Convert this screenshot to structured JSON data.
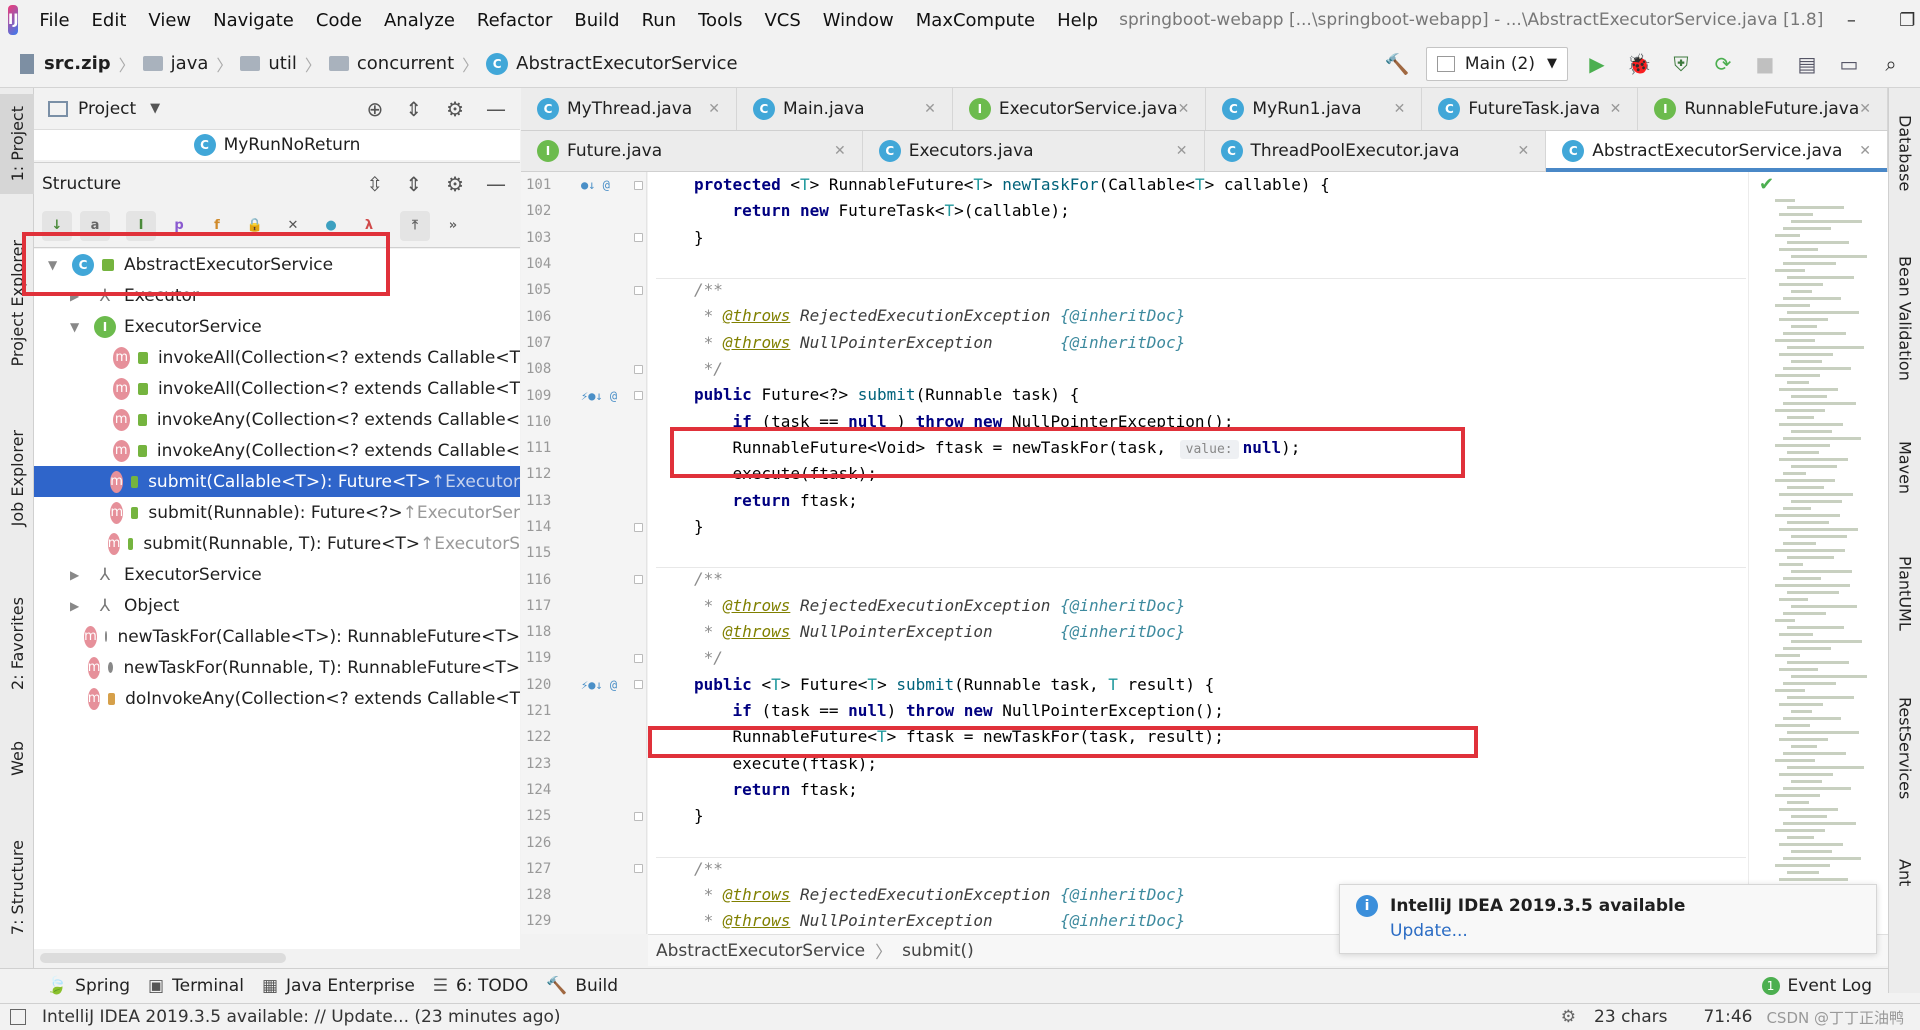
{
  "window": {
    "title": "springboot-webapp [...\\springboot-webapp] - ...\\AbstractExecutorService.java [1.8]",
    "controls": [
      "–",
      "❐",
      "✕"
    ]
  },
  "menu": [
    "File",
    "Edit",
    "View",
    "Navigate",
    "Code",
    "Analyze",
    "Refactor",
    "Build",
    "Run",
    "Tools",
    "VCS",
    "Window",
    "MaxCompute",
    "Help"
  ],
  "breadcrumb": [
    "src.zip",
    "java",
    "util",
    "concurrent",
    "AbstractExecutorService"
  ],
  "run_config": "Main (2)",
  "left_tabs": [
    "1: Project",
    "Project Explorer",
    "Job Explorer",
    "2: Favorites",
    "Web",
    "7: Structure"
  ],
  "right_tabs": [
    "Database",
    "Bean Validation",
    "Maven",
    "PlantUML",
    "RestServices",
    "Ant"
  ],
  "project_panel": {
    "title": "Project",
    "file": "MyRunNoReturn"
  },
  "structure_panel": {
    "title": "Structure"
  },
  "tree": [
    {
      "text": "AbstractExecutorService",
      "suffix": "",
      "indent": 0,
      "icon": "C",
      "arrow": "▼",
      "acc": "lock"
    },
    {
      "text": "Executor",
      "suffix": "",
      "indent": 1,
      "icon": "inherit",
      "arrow": "▶",
      "acc": ""
    },
    {
      "text": "ExecutorService",
      "suffix": "",
      "indent": 1,
      "icon": "I",
      "arrow": "▼",
      "acc": ""
    },
    {
      "text": "invokeAll(Collection<? extends Callable<T",
      "suffix": "",
      "indent": 2,
      "icon": "m",
      "arrow": "",
      "acc": "lock"
    },
    {
      "text": "invokeAll(Collection<? extends Callable<T",
      "suffix": "",
      "indent": 2,
      "icon": "m",
      "arrow": "",
      "acc": "lock"
    },
    {
      "text": "invokeAny(Collection<? extends Callable<",
      "suffix": "",
      "indent": 2,
      "icon": "m",
      "arrow": "",
      "acc": "lock"
    },
    {
      "text": "invokeAny(Collection<? extends Callable<",
      "suffix": "",
      "indent": 2,
      "icon": "m",
      "arrow": "",
      "acc": "lock"
    },
    {
      "text": "submit(Callable<T>): Future<T> ",
      "suffix": "↑Executor",
      "indent": 2,
      "icon": "m",
      "arrow": "",
      "acc": "lock",
      "selected": true
    },
    {
      "text": "submit(Runnable): Future<?> ",
      "suffix": "↑ExecutorSer",
      "indent": 2,
      "icon": "m",
      "arrow": "",
      "acc": "lock"
    },
    {
      "text": "submit(Runnable, T): Future<T> ",
      "suffix": "↑ExecutorS",
      "indent": 2,
      "icon": "m",
      "arrow": "",
      "acc": "lock"
    },
    {
      "text": "ExecutorService",
      "suffix": "",
      "indent": 1,
      "icon": "inherit",
      "arrow": "▶",
      "acc": ""
    },
    {
      "text": "Object",
      "suffix": "",
      "indent": 1,
      "icon": "inherit",
      "arrow": "▶",
      "acc": ""
    },
    {
      "text": "newTaskFor(Callable<T>): RunnableFuture<T>",
      "suffix": "",
      "indent": 1,
      "icon": "m",
      "arrow": "",
      "acc": "key"
    },
    {
      "text": "newTaskFor(Runnable, T): RunnableFuture<T>",
      "suffix": "",
      "indent": 1,
      "icon": "m",
      "arrow": "",
      "acc": "key"
    },
    {
      "text": "doInvokeAny(Collection<? extends Callable<T",
      "suffix": "",
      "indent": 1,
      "icon": "m",
      "arrow": "",
      "acc": "private"
    }
  ],
  "tabs_row1": [
    {
      "label": "MyThread.java",
      "icon": "C"
    },
    {
      "label": "Main.java",
      "icon": "C"
    },
    {
      "label": "ExecutorService.java",
      "icon": "I"
    },
    {
      "label": "MyRun1.java",
      "icon": "C"
    },
    {
      "label": "FutureTask.java",
      "icon": "C"
    },
    {
      "label": "RunnableFuture.java",
      "icon": "I"
    }
  ],
  "tabs_row2": [
    {
      "label": "Future.java",
      "icon": "I"
    },
    {
      "label": "Executors.java",
      "icon": "C"
    },
    {
      "label": "ThreadPoolExecutor.java",
      "icon": "C"
    },
    {
      "label": "AbstractExecutorService.java",
      "icon": "C",
      "active": true
    }
  ],
  "gutter": [
    {
      "n": "101",
      "icons": "●↓ @",
      "fold": true
    },
    {
      "n": "102",
      "icons": "",
      "fold": false
    },
    {
      "n": "103",
      "icons": "",
      "fold": true
    },
    {
      "n": "104",
      "icons": "",
      "fold": false
    },
    {
      "n": "105",
      "icons": "",
      "fold": true
    },
    {
      "n": "106",
      "icons": "",
      "fold": false
    },
    {
      "n": "107",
      "icons": "",
      "fold": false
    },
    {
      "n": "108",
      "icons": "",
      "fold": true
    },
    {
      "n": "109",
      "icons": "⚡●↓ @",
      "fold": true
    },
    {
      "n": "110",
      "icons": "",
      "fold": false
    },
    {
      "n": "111",
      "icons": "",
      "fold": false
    },
    {
      "n": "112",
      "icons": "",
      "fold": false
    },
    {
      "n": "113",
      "icons": "",
      "fold": false
    },
    {
      "n": "114",
      "icons": "",
      "fold": true
    },
    {
      "n": "115",
      "icons": "",
      "fold": false
    },
    {
      "n": "116",
      "icons": "",
      "fold": true
    },
    {
      "n": "117",
      "icons": "",
      "fold": false
    },
    {
      "n": "118",
      "icons": "",
      "fold": false
    },
    {
      "n": "119",
      "icons": "",
      "fold": true
    },
    {
      "n": "120",
      "icons": "⚡●↓ @",
      "fold": true
    },
    {
      "n": "121",
      "icons": "",
      "fold": false
    },
    {
      "n": "122",
      "icons": "",
      "fold": false
    },
    {
      "n": "123",
      "icons": "",
      "fold": false
    },
    {
      "n": "124",
      "icons": "",
      "fold": false
    },
    {
      "n": "125",
      "icons": "",
      "fold": true
    },
    {
      "n": "126",
      "icons": "",
      "fold": false
    },
    {
      "n": "127",
      "icons": "",
      "fold": true
    },
    {
      "n": "128",
      "icons": "",
      "fold": false
    },
    {
      "n": "129",
      "icons": "",
      "fold": false
    }
  ],
  "code": [
    [
      [
        "kw",
        "protected "
      ],
      [
        "",
        "<"
      ],
      [
        "tp",
        "T"
      ],
      [
        "",
        "> RunnableFuture<"
      ],
      [
        "tp",
        "T"
      ],
      [
        "",
        "> "
      ],
      [
        "mth",
        "newTaskFor"
      ],
      [
        "",
        "(Callable<"
      ],
      [
        "tp",
        "T"
      ],
      [
        "",
        "> callable) {"
      ]
    ],
    [
      [
        "",
        "    "
      ],
      [
        "kw",
        "return new "
      ],
      [
        "",
        "FutureTask<"
      ],
      [
        "tp",
        "T"
      ],
      [
        "",
        ">(callable);"
      ]
    ],
    [
      [
        "",
        "}"
      ]
    ],
    [],
    [
      [
        "cm",
        "/**"
      ]
    ],
    [
      [
        "cm",
        " * "
      ],
      [
        "ct",
        "@throws"
      ],
      [
        "ctl",
        " RejectedExecutionException "
      ],
      [
        "cd",
        "{@inheritDoc}"
      ]
    ],
    [
      [
        "cm",
        " * "
      ],
      [
        "ct",
        "@throws"
      ],
      [
        "ctl",
        " NullPointerException       "
      ],
      [
        "cd",
        "{@inheritDoc}"
      ]
    ],
    [
      [
        "cm",
        " */"
      ]
    ],
    [
      [
        "kw",
        "public "
      ],
      [
        "",
        "Future<?> "
      ],
      [
        "mth",
        "submit"
      ],
      [
        "",
        "(Runnable task) {"
      ]
    ],
    [
      [
        "",
        "    "
      ],
      [
        "kw",
        "if "
      ],
      [
        "",
        "(task == "
      ],
      [
        "kw",
        "null"
      ],
      [
        "",
        " ) "
      ],
      [
        "kw",
        "throw new "
      ],
      [
        "",
        "NullPointerException();"
      ]
    ],
    [
      [
        "",
        "    RunnableFuture<Void> ftask = newTaskFor(task, "
      ],
      [
        "hint",
        "value:"
      ],
      [
        "kw",
        "null"
      ],
      [
        "",
        ");"
      ]
    ],
    [
      [
        "",
        "    execute(ftask);"
      ]
    ],
    [
      [
        "",
        "    "
      ],
      [
        "kw",
        "return "
      ],
      [
        "",
        "ftask;"
      ]
    ],
    [
      [
        "",
        "}"
      ]
    ],
    [],
    [
      [
        "cm",
        "/**"
      ]
    ],
    [
      [
        "cm",
        " * "
      ],
      [
        "ct",
        "@throws"
      ],
      [
        "ctl",
        " RejectedExecutionException "
      ],
      [
        "cd",
        "{@inheritDoc}"
      ]
    ],
    [
      [
        "cm",
        " * "
      ],
      [
        "ct",
        "@throws"
      ],
      [
        "ctl",
        " NullPointerException       "
      ],
      [
        "cd",
        "{@inheritDoc}"
      ]
    ],
    [
      [
        "cm",
        " */"
      ]
    ],
    [
      [
        "kw",
        "public "
      ],
      [
        "",
        "<"
      ],
      [
        "tp",
        "T"
      ],
      [
        "",
        "> Future<"
      ],
      [
        "tp",
        "T"
      ],
      [
        "",
        "> "
      ],
      [
        "mth",
        "submit"
      ],
      [
        "",
        "(Runnable task, "
      ],
      [
        "tp",
        "T"
      ],
      [
        "",
        " result) {"
      ]
    ],
    [
      [
        "",
        "    "
      ],
      [
        "kw",
        "if "
      ],
      [
        "",
        "(task == "
      ],
      [
        "kw",
        "null"
      ],
      [
        "",
        ") "
      ],
      [
        "kw",
        "throw new "
      ],
      [
        "",
        "NullPointerException();"
      ]
    ],
    [
      [
        "",
        "    RunnableFuture<"
      ],
      [
        "tp",
        "T"
      ],
      [
        "",
        "> ftask = newTaskFor(task, result);"
      ]
    ],
    [
      [
        "",
        "    execute(ftask);"
      ]
    ],
    [
      [
        "",
        "    "
      ],
      [
        "kw",
        "return "
      ],
      [
        "",
        "ftask;"
      ]
    ],
    [
      [
        "",
        "}"
      ]
    ],
    [],
    [
      [
        "cm",
        "/**"
      ]
    ],
    [
      [
        "cm",
        " * "
      ],
      [
        "ct",
        "@throws"
      ],
      [
        "ctl",
        " RejectedExecutionException "
      ],
      [
        "cd",
        "{@inheritDoc}"
      ]
    ],
    [
      [
        "cm",
        " * "
      ],
      [
        "ct",
        "@throws"
      ],
      [
        "ctl",
        " NullPointerException       "
      ],
      [
        "cd",
        "{@inheritDoc}"
      ]
    ]
  ],
  "editor_crumb": [
    "AbstractExecutorService",
    "submit()"
  ],
  "notification": {
    "title": "IntelliJ IDEA 2019.3.5 available",
    "link": "Update..."
  },
  "toolwindows": [
    {
      "label": "Spring",
      "icon": "🍃"
    },
    {
      "label": "Terminal",
      "icon": "▣"
    },
    {
      "label": "Java Enterprise",
      "icon": "▦"
    },
    {
      "label": "6: TODO",
      "icon": "☰"
    },
    {
      "label": "Build",
      "icon": "🔨"
    }
  ],
  "event_log": "Event Log",
  "status": {
    "message": "IntelliJ IDEA 2019.3.5 available: // Update... (23 minutes ago)",
    "chars": "23 chars",
    "pos": "71:46",
    "watermark": "CSDN @丁丁正油鸭"
  }
}
